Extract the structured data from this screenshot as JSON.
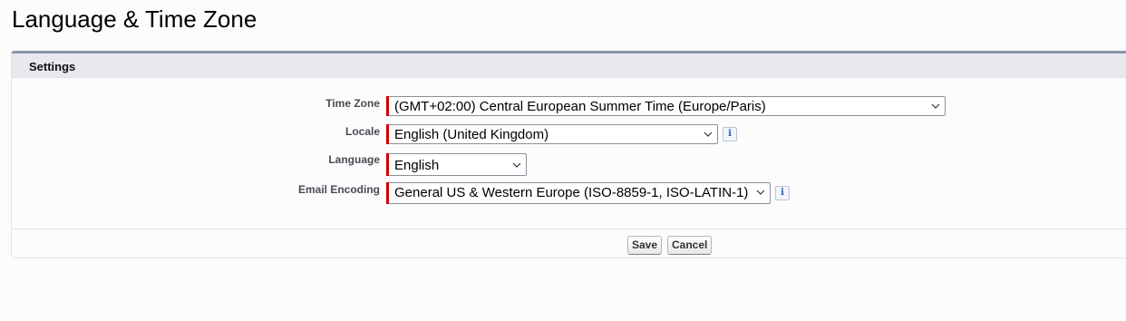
{
  "page": {
    "title": "Language & Time Zone"
  },
  "section": {
    "title": "Settings"
  },
  "fields": {
    "time_zone": {
      "label": "Time Zone",
      "value": "(GMT+02:00) Central European Summer Time (Europe/Paris)"
    },
    "locale": {
      "label": "Locale",
      "value": "English (United Kingdom)"
    },
    "language": {
      "label": "Language",
      "value": "English"
    },
    "email_encoding": {
      "label": "Email Encoding",
      "value": "General US & Western Europe (ISO-8859-1, ISO-LATIN-1)"
    }
  },
  "buttons": {
    "save": "Save",
    "cancel": "Cancel"
  },
  "icons": {
    "info": "info-icon",
    "dropdown": "chevron-down-icon"
  },
  "colors": {
    "required": "#cc0000",
    "section_header_bg": "#e7e9ef",
    "section_top_border": "#8a94a8"
  }
}
